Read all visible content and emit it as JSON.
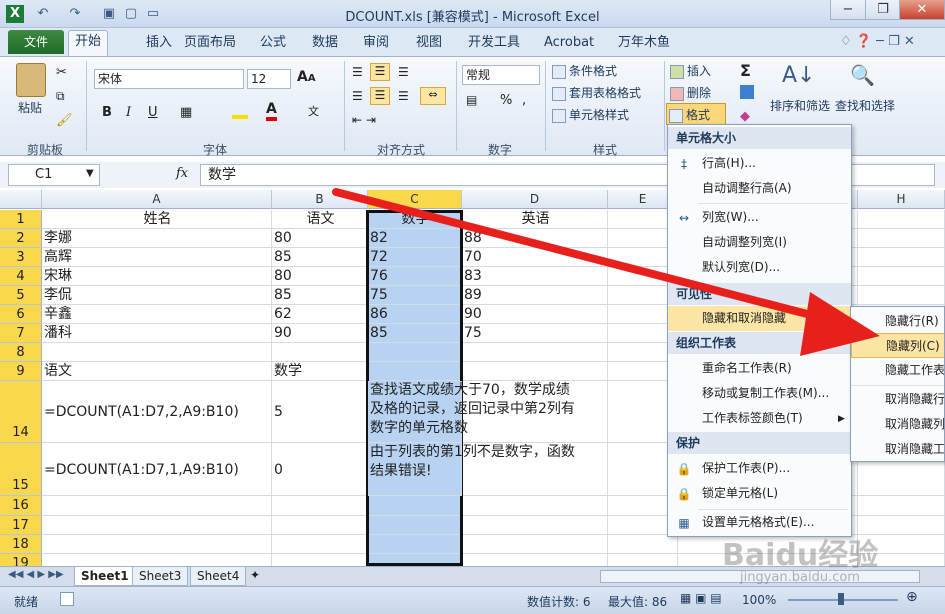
{
  "title": "DCOUNT.xls  [兼容模式] - Microsoft Excel",
  "tabs": [
    "文件",
    "开始",
    "插入",
    "页面布局",
    "公式",
    "数据",
    "审阅",
    "视图",
    "开发工具",
    "Acrobat",
    "万年木鱼"
  ],
  "ribbon": {
    "paste": "粘贴",
    "clipboard": "剪贴板",
    "font_name": "宋体",
    "font_size": "12",
    "font_group": "字体",
    "align_group": "对齐方式",
    "number_format": "常规",
    "number_group": "数字",
    "cond_format": "条件格式",
    "table_format": "套用表格格式",
    "cell_style": "单元格样式",
    "style_group": "样式",
    "insert": "插入",
    "delete": "删除",
    "format": "格式",
    "sort_filter": "排序和筛选",
    "find_select": "查找和选择"
  },
  "namebox": "C1",
  "fx": "fx",
  "formula": "数学",
  "columns": [
    "A",
    "B",
    "C",
    "D",
    "E",
    "H"
  ],
  "rows": [
    {
      "n": "1",
      "a": "姓名",
      "b": "语文",
      "c": "数学",
      "d": "英语"
    },
    {
      "n": "2",
      "a": "李娜",
      "b": "80",
      "c": "82",
      "d": "88"
    },
    {
      "n": "3",
      "a": "高辉",
      "b": "85",
      "c": "72",
      "d": "70"
    },
    {
      "n": "4",
      "a": "宋琳",
      "b": "80",
      "c": "76",
      "d": "83"
    },
    {
      "n": "5",
      "a": "李侃",
      "b": "85",
      "c": "75",
      "d": "89"
    },
    {
      "n": "6",
      "a": "辛鑫",
      "b": "62",
      "c": "86",
      "d": "90"
    },
    {
      "n": "7",
      "a": "潘科",
      "b": "90",
      "c": "85",
      "d": "75"
    },
    {
      "n": "8",
      "a": "",
      "b": "",
      "c": "",
      "d": ""
    },
    {
      "n": "9",
      "a": "语文",
      "b": "数学",
      "c": "",
      "d": ""
    },
    {
      "n": "14",
      "a": "=DCOUNT(A1:D7,2,A9:B10)",
      "b": "5",
      "c": "查找语文成绩大于70，数学成绩\n及格的记录，返回记录中第2列有\n数字的单元格数",
      "d": ""
    },
    {
      "n": "15",
      "a": "=DCOUNT(A1:D7,1,A9:B10)",
      "b": "0",
      "c": "由于列表的第1列不是数字，函数\n结果错误!",
      "d": ""
    },
    {
      "n": "16"
    },
    {
      "n": "17"
    },
    {
      "n": "18"
    },
    {
      "n": "19"
    }
  ],
  "menu": {
    "h1": "单元格大小",
    "row_height": "行高(H)...",
    "autofit_row": "自动调整行高(A)",
    "col_width": "列宽(W)...",
    "autofit_col": "自动调整列宽(I)",
    "default_width": "默认列宽(D)...",
    "h2": "可见性",
    "hide_unhide": "隐藏和取消隐藏",
    "h3": "组织工作表",
    "rename": "重命名工作表(R)",
    "move_copy": "移动或复制工作表(M)...",
    "tab_color": "工作表标签颜色(T)",
    "h4": "保护",
    "protect": "保护工作表(P)...",
    "lock": "锁定单元格(L)",
    "format_cells": "设置单元格格式(E)..."
  },
  "submenu": [
    "隐藏行(R)",
    "隐藏列(C)",
    "隐藏工作表",
    "取消隐藏行",
    "取消隐藏列",
    "取消隐藏工"
  ],
  "sheets": [
    "Sheet1",
    "Sheet3",
    "Sheet4"
  ],
  "status": {
    "mode": "就绪",
    "count": "数值计数: 6",
    "max": "最大值: 86",
    "zoom": "100%"
  },
  "watermark": "Baidu经验",
  "watermark_url": "jingyan.baidu.com",
  "colors": {
    "selection": "#b8d3f2",
    "highlight": "#fde6a5",
    "arrow": "#e8201c"
  }
}
